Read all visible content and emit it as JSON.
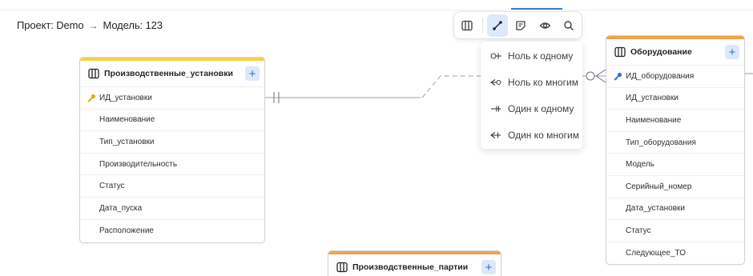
{
  "breadcrumb": {
    "project": "Проект: Demo",
    "separator": "→",
    "model": "Модель: 123"
  },
  "toolbar": {
    "buttons": [
      {
        "name": "table-icon",
        "active": false
      },
      {
        "name": "relation-icon",
        "active": true
      },
      {
        "name": "note-icon",
        "active": false
      },
      {
        "name": "eye-icon",
        "active": false
      },
      {
        "name": "search-icon",
        "active": false
      }
    ]
  },
  "relation_menu": {
    "items": [
      {
        "label": "Ноль к одному",
        "icon": "zero-to-one-icon"
      },
      {
        "label": "Ноль ко многим",
        "icon": "zero-to-many-icon"
      },
      {
        "label": "Один к одному",
        "icon": "one-to-one-icon"
      },
      {
        "label": "Один ко многим",
        "icon": "one-to-many-icon"
      }
    ]
  },
  "entities": {
    "installations": {
      "title": "Производственные_установки",
      "accent": "#f7cf45",
      "fields": [
        {
          "name": "ИД_установки",
          "key": true
        },
        {
          "name": "Наименование",
          "key": false
        },
        {
          "name": "Тип_установки",
          "key": false
        },
        {
          "name": "Производительность",
          "key": false
        },
        {
          "name": "Статус",
          "key": false
        },
        {
          "name": "Дата_пуска",
          "key": false
        },
        {
          "name": "Расположение",
          "key": false
        }
      ]
    },
    "equipment": {
      "title": "Оборудование",
      "accent": "#f5a04a",
      "fields": [
        {
          "name": "ИД_оборудования",
          "key": true
        },
        {
          "name": "ИД_установки",
          "key": false
        },
        {
          "name": "Наименование",
          "key": false
        },
        {
          "name": "Тип_оборудования",
          "key": false
        },
        {
          "name": "Модель",
          "key": false
        },
        {
          "name": "Серийный_номер",
          "key": false
        },
        {
          "name": "Дата_установки",
          "key": false
        },
        {
          "name": "Статус",
          "key": false
        },
        {
          "name": "Следующее_ТО",
          "key": false
        }
      ]
    },
    "batches": {
      "title": "Производственные_партии",
      "accent": "#f5a04a",
      "fields": []
    }
  },
  "colors": {
    "accent_blue": "#3a7bd5",
    "active_bg": "#dce8fb",
    "key_primary": "#e8a800",
    "key_foreign": "#2f6fd1"
  }
}
